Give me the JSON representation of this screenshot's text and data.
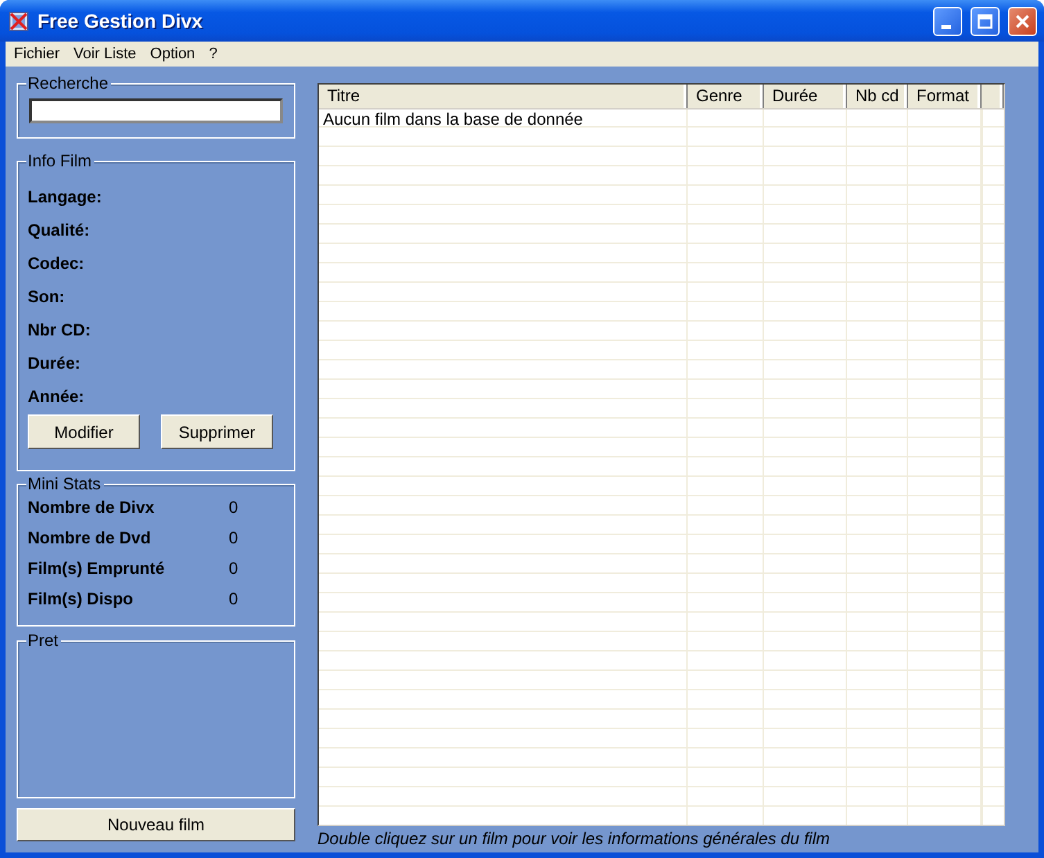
{
  "window": {
    "title": "Free Gestion Divx"
  },
  "menu": [
    "Fichier",
    "Voir Liste",
    "Option",
    "?"
  ],
  "search": {
    "title": "Recherche"
  },
  "info_film": {
    "title": "Info Film",
    "fields": [
      "Langage:",
      "Qualité:",
      "Codec:",
      "Son:",
      "Nbr CD:",
      "Durée:",
      "Année:"
    ],
    "buttons": [
      "Modifier",
      "Supprimer"
    ]
  },
  "mini_stats": {
    "title": "Mini Stats",
    "rows": [
      {
        "label": "Nombre de Divx",
        "value": "0"
      },
      {
        "label": "Nombre de Dvd",
        "value": "0"
      },
      {
        "label": "Film(s) Emprunté",
        "value": "0"
      },
      {
        "label": "Film(s) Dispo",
        "value": "0"
      }
    ]
  },
  "pret": {
    "title": "Pret"
  },
  "new_button": "Nouveau film",
  "table": {
    "columns": [
      "Titre",
      "Genre",
      "Durée",
      "Nb cd",
      "Format"
    ],
    "rows": [
      {
        "cells": [
          "Aucun film dans la base de donnée"
        ]
      }
    ]
  },
  "hint": "Double cliquez sur un film pour voir les informations générales du film"
}
